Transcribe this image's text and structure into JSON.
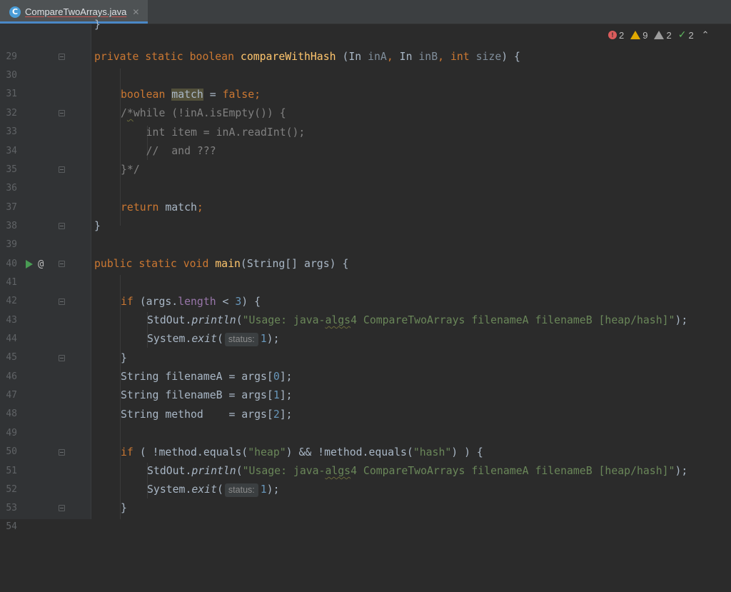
{
  "tab": {
    "filename": "CompareTwoArrays.java",
    "close_symbol": "✕",
    "icon_letter": "C"
  },
  "inspections": {
    "errors": "2",
    "warnings": "9",
    "weak_warnings": "2",
    "typos": "2"
  },
  "colors": {
    "background": "#2b2b2b",
    "keyword": "#cc7832",
    "function": "#ffc66d",
    "string": "#6a8759",
    "number": "#6897bb",
    "comment": "#808080",
    "field": "#9876aa"
  },
  "lines": [
    {
      "n": "29"
    },
    {
      "n": "30"
    },
    {
      "n": "31"
    },
    {
      "n": "32"
    },
    {
      "n": "33"
    },
    {
      "n": "34"
    },
    {
      "n": "35"
    },
    {
      "n": "36"
    },
    {
      "n": "37"
    },
    {
      "n": "38"
    },
    {
      "n": "39"
    },
    {
      "n": "40"
    },
    {
      "n": "41"
    },
    {
      "n": "42"
    },
    {
      "n": "43"
    },
    {
      "n": "44"
    },
    {
      "n": "45"
    },
    {
      "n": "46"
    },
    {
      "n": "47"
    },
    {
      "n": "48"
    },
    {
      "n": "49"
    },
    {
      "n": "50"
    },
    {
      "n": "51"
    },
    {
      "n": "52"
    },
    {
      "n": "53"
    },
    {
      "n": "54"
    }
  ],
  "code": {
    "l29": "}",
    "l30": {
      "kw": "private static boolean ",
      "fn": "compareWithHash",
      "p1": " (In ",
      "a1": "inA",
      "comma1": ", ",
      "p2": "In ",
      "a2": "inB",
      "comma2": ", ",
      "kw2": "int ",
      "a3": "size",
      "end": ") {"
    },
    "l32": {
      "kw": "boolean ",
      "var": "match",
      "eq": " = ",
      "val": "false;"
    },
    "l33": {
      "open": "/",
      "star": "*",
      "rest": "while (!inA.isEmpty()) {"
    },
    "l34": "    int item = inA.readInt();",
    "l35": "    //  and ???",
    "l36": "}*/",
    "l38": {
      "kw": "return ",
      "rest": "match",
      "semi": ";"
    },
    "l39": "}",
    "l41": {
      "kw": "public static void ",
      "fn": "main",
      "rest": "(String[] args) {"
    },
    "l43": {
      "kw": "if ",
      "p1": "(args.",
      "fld": "length",
      "p2": " < ",
      "num": "3",
      "end": ") {"
    },
    "l44": {
      "cls": "StdOut.",
      "m": "println",
      "open": "(",
      "s1": "\"Usage: java-",
      "s2": "algs",
      "s3": "4 CompareTwoArrays filenameA filenameB [heap/hash]\"",
      "end": ");"
    },
    "l45": {
      "cls": "System.",
      "m": "exit",
      "open": "(",
      "hint": "status:",
      "num": "1",
      "end": ");"
    },
    "l46": "}",
    "l47": {
      "t": "String filenameA = args[",
      "num": "0",
      "end": "];"
    },
    "l48": {
      "t": "String filenameB = args[",
      "num": "1",
      "end": "];"
    },
    "l49": {
      "t": "String method    = args[",
      "num": "2",
      "end": "];"
    },
    "l51": {
      "kw": "if ",
      "p1": "( !method.equals(",
      "s1": "\"heap\"",
      "p2": ") && !method.equals(",
      "s2": "\"hash\"",
      "end": ") ) {"
    },
    "l52": {
      "cls": "StdOut.",
      "m": "println",
      "open": "(",
      "s1": "\"Usage: java-",
      "s2": "algs",
      "s3": "4 CompareTwoArrays filenameA filenameB [heap/hash]\"",
      "end": ");"
    },
    "l53": {
      "cls": "System.",
      "m": "exit",
      "open": "(",
      "hint": "status:",
      "num": "1",
      "end": ");"
    },
    "l54": "}"
  },
  "gutter": {
    "at_symbol": "@"
  }
}
